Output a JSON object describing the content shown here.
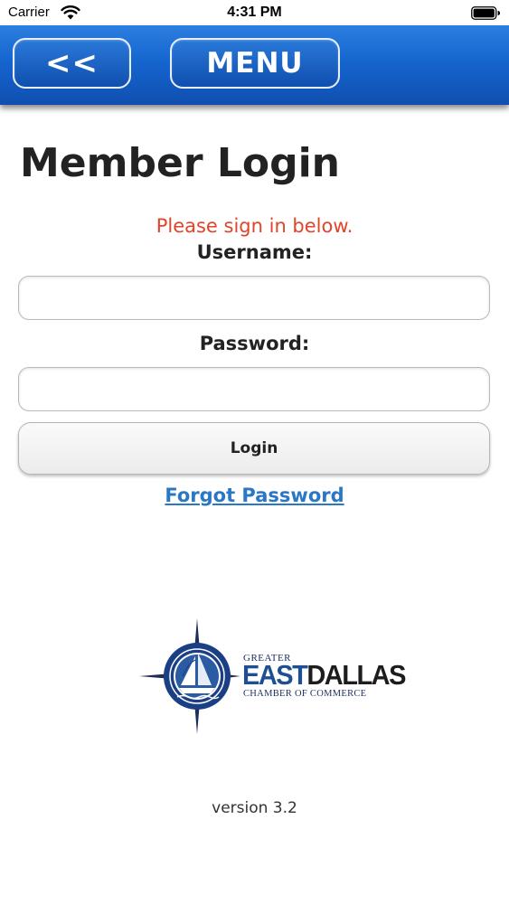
{
  "status_bar": {
    "carrier": "Carrier",
    "time": "4:31 PM"
  },
  "header": {
    "back_label": "<<",
    "menu_label": "MENU"
  },
  "page": {
    "title": "Member Login",
    "sign_in_message": "Please sign in below.",
    "username_label": "Username:",
    "username_value": "",
    "password_label": "Password:",
    "password_value": "",
    "login_label": "Login",
    "forgot_label": "Forgot Password"
  },
  "logo": {
    "line1": "GREATER",
    "east": "EAST",
    "dallas": "DALLAS",
    "line3": "CHAMBER OF COMMERCE"
  },
  "footer": {
    "version": "version 3.2"
  },
  "colors": {
    "header_blue": "#1565cf",
    "message_red": "#e2432a",
    "link_blue": "#2a78c5",
    "logo_navy": "#1f4f93"
  }
}
